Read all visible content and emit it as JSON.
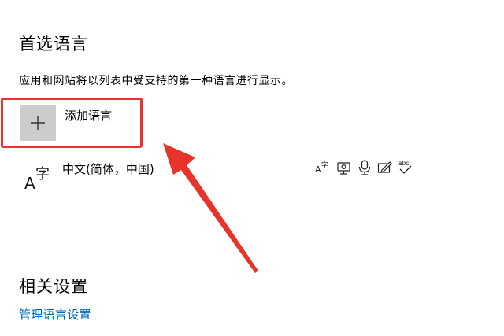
{
  "preferred_languages": {
    "title": "首选语言",
    "description": "应用和网站将以列表中受支持的第一种语言进行显示。",
    "add_language_label": "添加语言",
    "add_icon": "plus-icon",
    "languages": [
      {
        "name": "中文(简体，中国)",
        "icon": "language-glyph-icon",
        "glyph_small": "A",
        "glyph_large": "字",
        "features": [
          "display-language-icon",
          "speech-recognition-icon",
          "microphone-icon",
          "handwriting-icon",
          "spellcheck-icon"
        ],
        "feature_glyph_small": "字",
        "spellcheck_text": "abc"
      }
    ]
  },
  "related_settings": {
    "title": "相关设置",
    "manage_link": "管理语言设置"
  },
  "annotation": {
    "highlight_color": "#e8332b"
  },
  "colors": {
    "link": "#0067b8",
    "tile_background": "#cccccc"
  }
}
